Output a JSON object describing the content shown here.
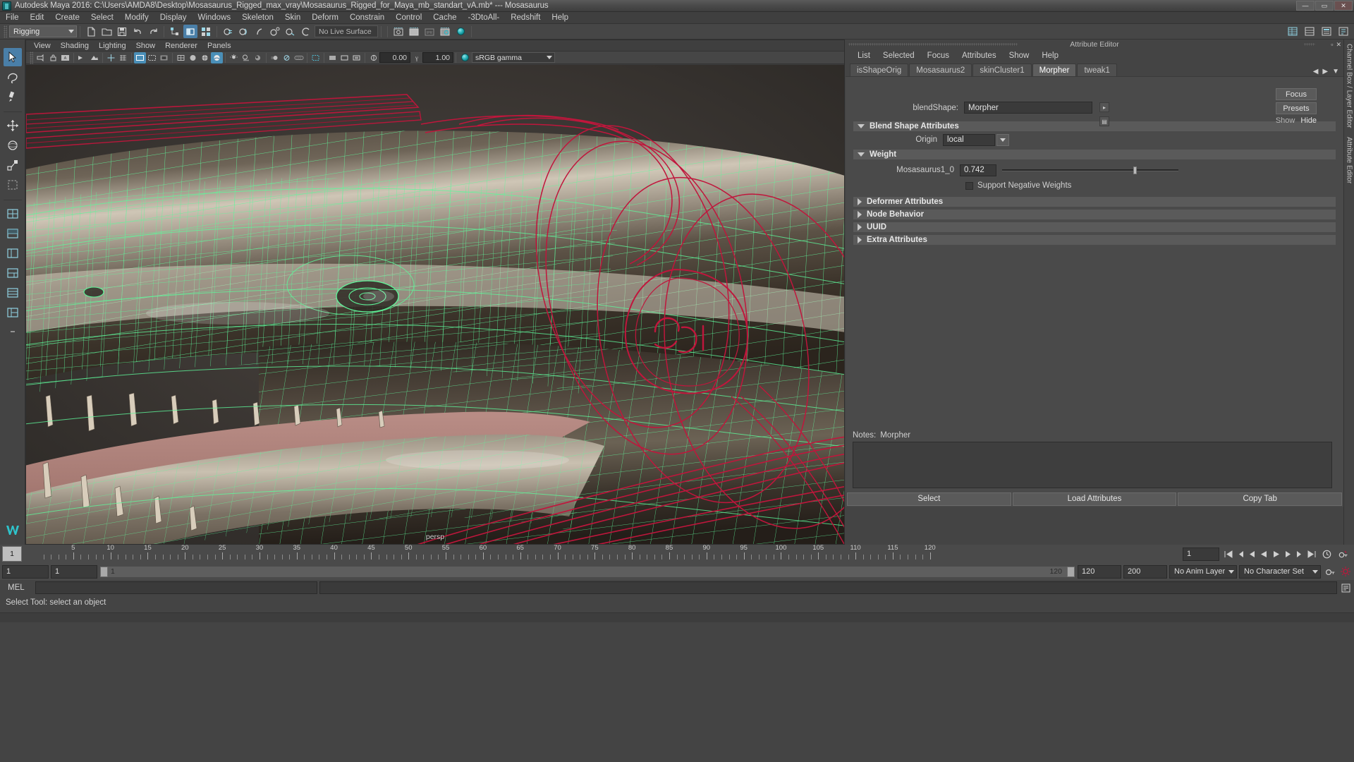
{
  "window": {
    "title": "Autodesk Maya 2016: C:\\Users\\AMDA8\\Desktop\\Mosasaurus_Rigged_max_vray\\Mosasaurus_Rigged_for_Maya_mb_standart_vA.mb*  ---  Mosasaurus",
    "icon": "maya-app-icon",
    "minimize": "—",
    "maximize": "▭",
    "close": "✕"
  },
  "menubar": {
    "items": [
      "File",
      "Edit",
      "Create",
      "Select",
      "Modify",
      "Display",
      "Windows",
      "Skeleton",
      "Skin",
      "Deform",
      "Constrain",
      "Control",
      "Cache",
      "-3DtoAll-",
      "Redshift",
      "Help"
    ]
  },
  "statusline": {
    "mode": "Rigging",
    "live_surface": "No Live Surface",
    "icons": [
      "new-scene-icon",
      "open-scene-icon",
      "save-scene-icon",
      "undo-icon",
      "redo-icon",
      "select-by-hierarchy-icon",
      "select-by-object-icon",
      "select-by-component-icon",
      "snap-to-grid-icon",
      "snap-to-curve-icon",
      "snap-to-point-icon",
      "snap-to-projected-center-icon",
      "snap-to-view-plane-icon",
      "make-live-icon",
      "show-hide-editor-icon",
      "render-view-icon",
      "render-current-frame-icon",
      "ipr-render-icon",
      "render-settings-icon",
      "hypershade-icon"
    ]
  },
  "toolbox": {
    "items": [
      {
        "name": "select-tool",
        "selected": true
      },
      {
        "name": "lasso-tool",
        "selected": false
      },
      {
        "name": "paint-select-tool",
        "selected": false
      },
      {
        "name": "move-tool",
        "selected": false
      },
      {
        "name": "rotate-tool",
        "selected": false
      },
      {
        "name": "scale-tool",
        "selected": false
      },
      {
        "name": "last-tool",
        "selected": false
      },
      {
        "name": "single-view-layout",
        "selected": false
      },
      {
        "name": "four-view-layout",
        "selected": false
      },
      {
        "name": "persp-outliner-layout",
        "selected": false
      },
      {
        "name": "persp-graph-layout",
        "selected": false
      },
      {
        "name": "hypershade-persp-layout",
        "selected": false
      },
      {
        "name": "persp-outliner-persp-layout",
        "selected": false
      },
      {
        "name": "more-layouts",
        "selected": false
      }
    ],
    "logo": "maya-logo-icon"
  },
  "viewport": {
    "menus": [
      "View",
      "Shading",
      "Lighting",
      "Show",
      "Renderer",
      "Panels"
    ],
    "camera_label": "persp",
    "exposure": "0.00",
    "gamma": "1.00",
    "color_management": "sRGB gamma",
    "toolbar_icons": [
      "select-camera-icon",
      "lock-camera-icon",
      "camera-attributes-icon",
      "bookmark-icon",
      "image-plane-icon",
      "2d-pan-zoom-icon",
      "grid-toggle-icon",
      "film-gate-icon",
      "resolution-gate-icon",
      "gate-mask-icon",
      "wireframe-icon",
      "smooth-shade-icon",
      "shaded-wireframe-icon",
      "textured-icon",
      "use-all-lights-icon",
      "shadows-icon",
      "screen-space-ao-icon",
      "motion-blur-icon",
      "multisample-aa-icon",
      "depth-of-field-icon",
      "isolate-select-icon",
      "xray-icon",
      "xray-joints-icon",
      "xray-active-components-icon",
      "exposure-icon",
      "gamma-icon",
      "color-management-icon"
    ]
  },
  "attribute_editor": {
    "panel_title": "Attribute Editor",
    "menus": [
      "List",
      "Selected",
      "Focus",
      "Attributes",
      "Show",
      "Help"
    ],
    "tabs": [
      {
        "label": "isShapeOrig",
        "active": false
      },
      {
        "label": "Mosasaurus2",
        "active": false
      },
      {
        "label": "skinCluster1",
        "active": false
      },
      {
        "label": "Morpher",
        "active": true
      },
      {
        "label": "tweak1",
        "active": false
      }
    ],
    "tab_nav": {
      "prev": "◀",
      "next": "▶",
      "menu": "▼"
    },
    "node_type_label": "blendShape:",
    "node_name": "Morpher",
    "side_buttons": [
      "Focus",
      "Presets"
    ],
    "show_label": "Show",
    "hide_label": "Hide",
    "sections": [
      {
        "name": "Blend Shape Attributes",
        "expanded": true
      },
      {
        "name": "Weight",
        "expanded": true
      },
      {
        "name": "Deformer Attributes",
        "expanded": false
      },
      {
        "name": "Node Behavior",
        "expanded": false
      },
      {
        "name": "UUID",
        "expanded": false
      },
      {
        "name": "Extra Attributes",
        "expanded": false
      }
    ],
    "origin_label": "Origin",
    "origin_value": "local",
    "weight": {
      "label": "Mosasaurus1_0",
      "value": "0.742",
      "slider_fraction": 0.742,
      "support_negative_label": "Support Negative Weights",
      "support_negative_checked": false
    },
    "notes_label": "Notes:",
    "notes_target": "Morpher",
    "notes_value": "",
    "footer_buttons": [
      "Select",
      "Load Attributes",
      "Copy Tab"
    ]
  },
  "right_strip": {
    "tabs": [
      "Channel Box / Layer Editor",
      "Attribute Editor"
    ]
  },
  "timeline": {
    "current_frame": "1",
    "tick_labels": [
      "5",
      "10",
      "15",
      "20",
      "25",
      "30",
      "35",
      "40",
      "45",
      "50",
      "55",
      "60",
      "65",
      "70",
      "75",
      "80",
      "85",
      "90",
      "95",
      "100",
      "105",
      "110",
      "115",
      "120"
    ],
    "end_display": "120",
    "frame_field": "1",
    "playback_icons": [
      "go-to-start-icon",
      "step-back-key-icon",
      "step-back-frame-icon",
      "play-backwards-icon",
      "play-forwards-icon",
      "step-forward-frame-icon",
      "step-forward-key-icon",
      "go-to-end-icon"
    ],
    "animation_prefs_icon": "animation-preferences-icon",
    "auto_key_icon": "auto-keyframe-icon"
  },
  "range_slider": {
    "anim_start": "1",
    "range_start": "1",
    "bar_start_label": "1",
    "bar_end_label": "120",
    "range_end": "120",
    "anim_end": "200",
    "anim_layer": "No Anim Layer",
    "character_set": "No Character Set",
    "key_icon": "set-key-icon",
    "settings_icon": "animation-settings-icon"
  },
  "command_line": {
    "label": "MEL",
    "input_value": "",
    "output_value": "",
    "script_editor_icon": "script-editor-icon"
  },
  "help_line": {
    "text": "Select Tool: select an object"
  },
  "colors": {
    "accent": "#4a7fa8",
    "panel_bg": "#444444",
    "wireframe_green": "#5ef79a",
    "rig_red": "#c0163c",
    "teal": "#18a4ab"
  }
}
